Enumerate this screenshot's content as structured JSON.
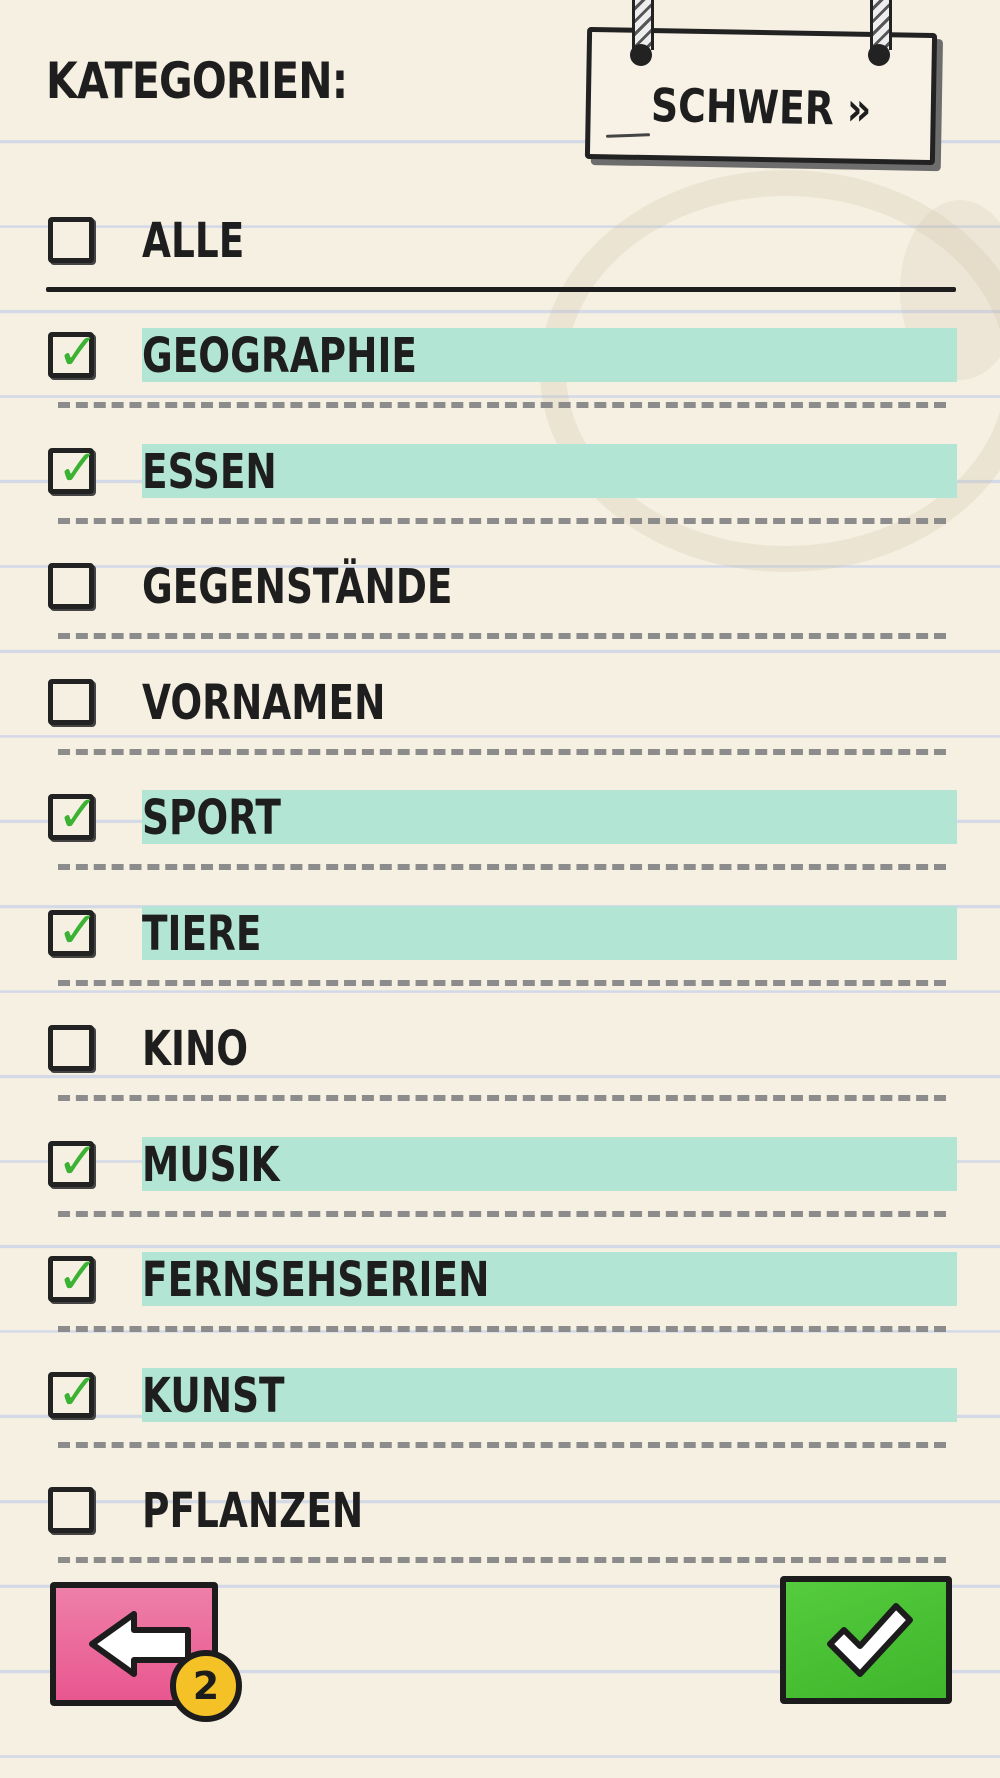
{
  "header": {
    "title": "KATEGORIEN:",
    "difficulty_label": "SCHWER »"
  },
  "all_option": {
    "label": "ALLE",
    "checked": false
  },
  "categories": [
    {
      "label": "GEOGRAPHIE",
      "checked": true
    },
    {
      "label": "ESSEN",
      "checked": true
    },
    {
      "label": "GEGENSTÄNDE",
      "checked": false
    },
    {
      "label": "VORNAMEN",
      "checked": false
    },
    {
      "label": "SPORT",
      "checked": true
    },
    {
      "label": "TIERE",
      "checked": true
    },
    {
      "label": "KINO",
      "checked": false
    },
    {
      "label": "MUSIK",
      "checked": true
    },
    {
      "label": "FERNSEHSERIEN",
      "checked": true
    },
    {
      "label": "KUNST",
      "checked": true
    },
    {
      "label": "PFLANZEN",
      "checked": false
    }
  ],
  "footer": {
    "back_cost": "2",
    "back_icon": "arrow-left-icon",
    "confirm_icon": "checkmark-icon"
  },
  "colors": {
    "paper": "#f6f0e2",
    "highlight": "#b2e5d4",
    "check": "#3bb233",
    "back_button": "#e8578f",
    "confirm_button": "#44bb2f",
    "coin": "#f4c226"
  }
}
